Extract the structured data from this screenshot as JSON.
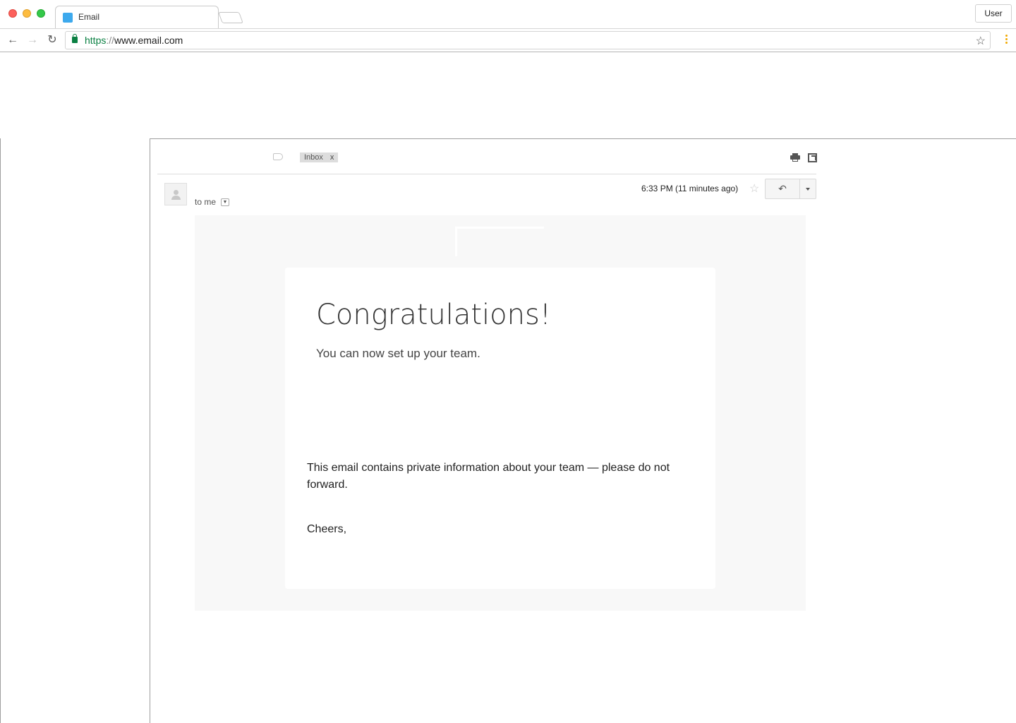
{
  "browser": {
    "tab_title": "Email",
    "url_scheme": "https",
    "url_sep": "://",
    "url_host": "www.email.com",
    "user_label": "User"
  },
  "email": {
    "label_chip": "Inbox",
    "label_chip_close": "x",
    "recipient": "to me",
    "timestamp": "6:33 PM (11 minutes ago)",
    "heading": "Congratulations!",
    "subheading": "You can now set up your team.",
    "notice": "This email contains private information about your team — please do not forward.",
    "signoff": "Cheers,"
  },
  "colors": {
    "secure_green": "#0b8043",
    "tab_favicon": "#3da9ed",
    "menu_dots": "#f2a900"
  }
}
